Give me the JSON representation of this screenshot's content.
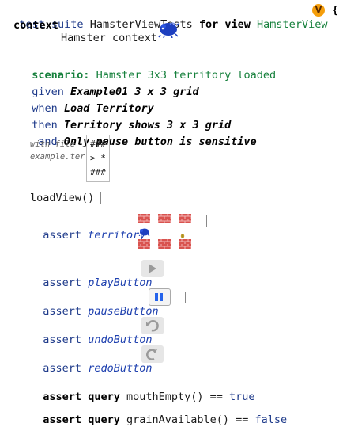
{
  "header": {
    "kw_test_suite": "test suite",
    "suite_name": "HamsterViewTests",
    "kw_for_view": "for view",
    "view_name": "HamsterView",
    "badge_letter": "V",
    "brace": "{"
  },
  "context": {
    "kw": "context",
    "value": "Hamster context"
  },
  "scenario": {
    "kw": "scenario:",
    "name": "Hamster 3x3 territory loaded",
    "given_kw": "given",
    "given_text": "Example01 3 x 3 grid",
    "when_kw": "when",
    "when_text": "Load Territory",
    "then_kw": "then",
    "then_text": "Territory shows 3 x 3 grid",
    "and_kw": "and",
    "and_text": "Only pause button is sensitive"
  },
  "example": {
    "label_line1": "with file",
    "label_line2": "example.ter",
    "grid_rows": [
      "###",
      "> *",
      "###"
    ]
  },
  "steps": {
    "load_view": "loadView()",
    "assert_kw": "assert",
    "territory": "territory",
    "play_button": "playButton",
    "pause_button": "pauseButton",
    "undo_button": "undoButton",
    "redo_button": "redoButton",
    "query_kw": "query",
    "query1_expr": "mouthEmpty() ==",
    "query1_value": "true",
    "query2_expr": "grainAvailable() ==",
    "query2_value": "false"
  },
  "colors": {
    "keyword": "#1e3a8a",
    "scenario_green": "#16803c",
    "wall_red": "#d9534f",
    "badge_orange": "#f59e0b"
  },
  "icons": {
    "hamster": "hamster-icon",
    "wall": "brick-wall-icon",
    "grain": "grain-icon",
    "play": "play-icon",
    "pause": "pause-icon",
    "undo": "undo-icon",
    "redo": "redo-icon"
  }
}
